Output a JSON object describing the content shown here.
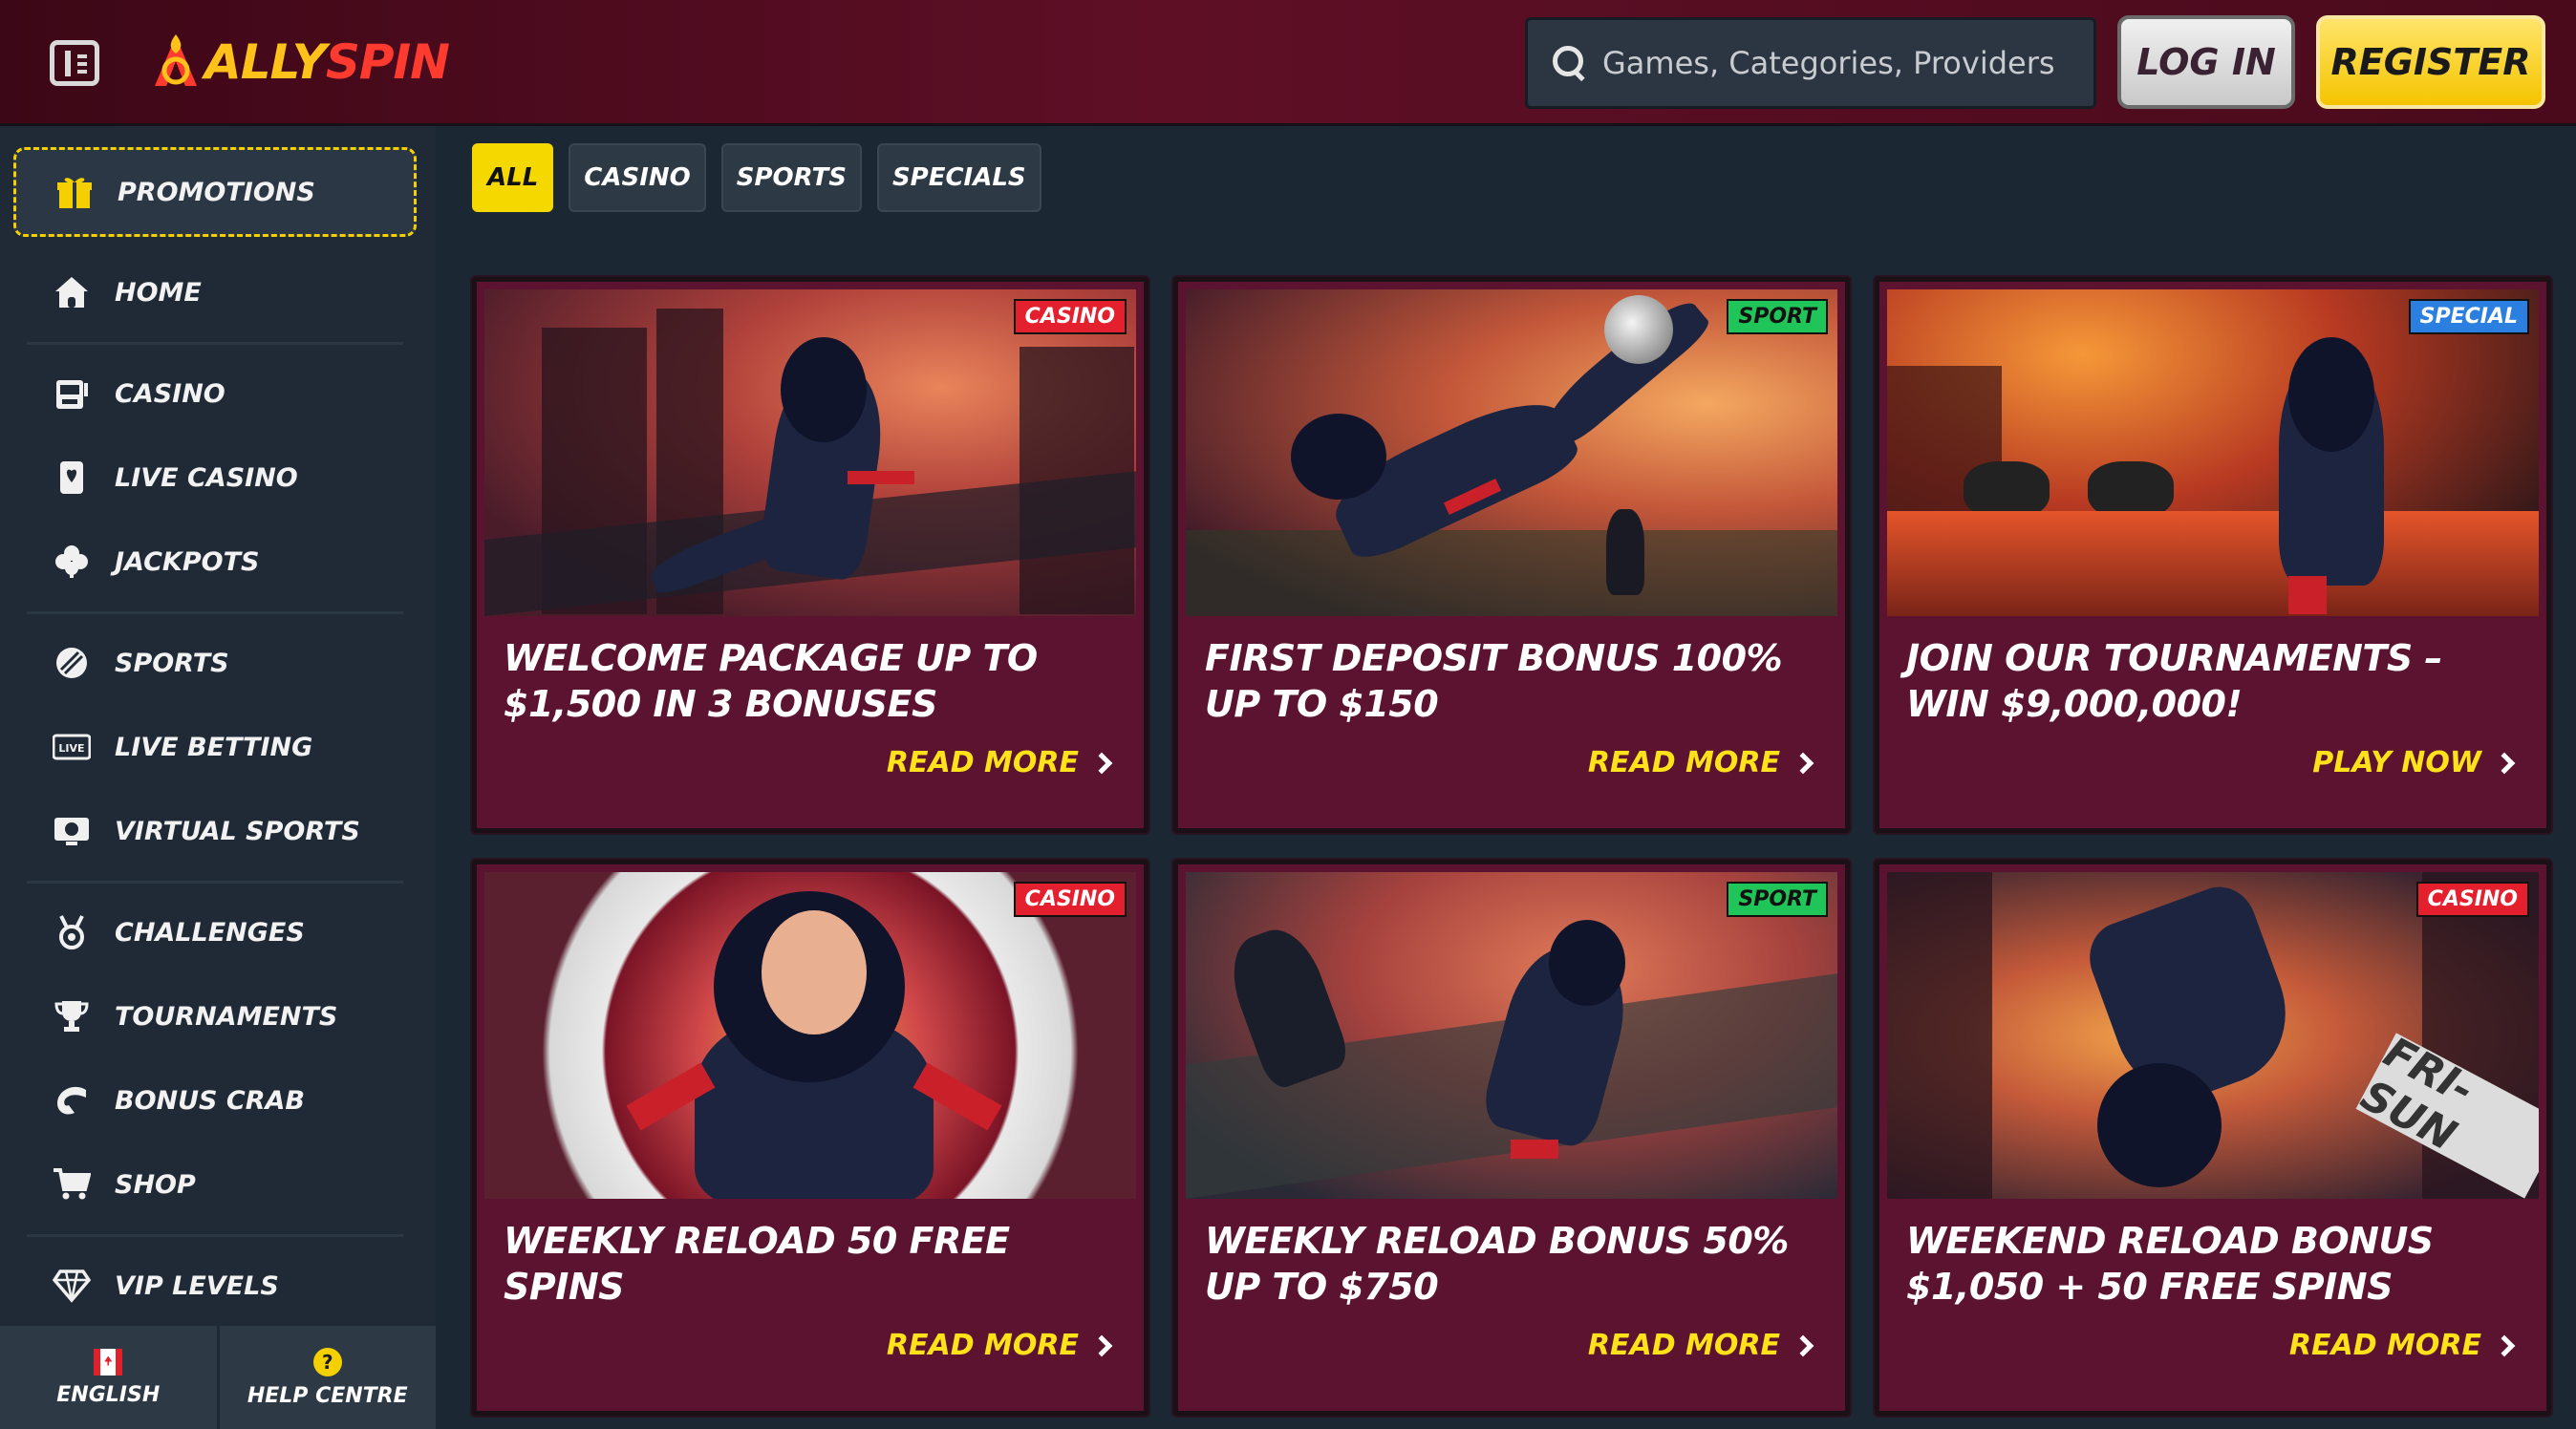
{
  "header": {
    "logo": "ALLYSPIN",
    "search_placeholder": "Games, Categories, Providers",
    "login_label": "LOG IN",
    "register_label": "REGISTER"
  },
  "sidebar": {
    "promotions_label": "PROMOTIONS",
    "items": [
      {
        "label": "HOME",
        "icon": "home-icon"
      },
      {
        "label": "CASINO",
        "icon": "slot-machine-icon"
      },
      {
        "label": "LIVE CASINO",
        "icon": "card-icon"
      },
      {
        "label": "JACKPOTS",
        "icon": "clover-icon"
      },
      {
        "label": "SPORTS",
        "icon": "football-icon"
      },
      {
        "label": "LIVE BETTING",
        "icon": "live-icon"
      },
      {
        "label": "VIRTUAL SPORTS",
        "icon": "virtual-sports-icon"
      },
      {
        "label": "CHALLENGES",
        "icon": "medal-icon"
      },
      {
        "label": "TOURNAMENTS",
        "icon": "trophy-icon"
      },
      {
        "label": "BONUS CRAB",
        "icon": "crab-claw-icon"
      },
      {
        "label": "SHOP",
        "icon": "cart-icon"
      },
      {
        "label": "VIP LEVELS",
        "icon": "diamond-icon"
      }
    ],
    "footer": {
      "language_label": "ENGLISH",
      "help_label": "HELP CENTRE",
      "help_glyph": "?"
    }
  },
  "filters": [
    {
      "label": "ALL",
      "active": true
    },
    {
      "label": "CASINO",
      "active": false
    },
    {
      "label": "SPORTS",
      "active": false
    },
    {
      "label": "SPECIALS",
      "active": false
    }
  ],
  "cards": [
    {
      "badge": "CASINO",
      "title": "WELCOME PACKAGE UP TO $1,500 IN 3 BONUSES",
      "cta": "READ MORE"
    },
    {
      "badge": "SPORT",
      "title": "FIRST DEPOSIT BONUS 100% UP TO $150",
      "cta": "READ MORE"
    },
    {
      "badge": "SPECIAL",
      "title": "JOIN OUR TOURNAMENTS – WIN $9,000,000!",
      "cta": "PLAY NOW"
    },
    {
      "badge": "CASINO",
      "title": "WEEKLY RELOAD 50 FREE SPINS",
      "cta": "READ MORE"
    },
    {
      "badge": "SPORT",
      "title": "WEEKLY RELOAD BONUS 50% UP TO $750",
      "cta": "READ MORE"
    },
    {
      "badge": "CASINO",
      "title": "WEEKEND RELOAD BONUS $1,050 + 50 FREE SPINS",
      "cta": "READ MORE",
      "image_sign_text": "FRI-SUN"
    }
  ],
  "colors": {
    "accent_yellow": "#f5d800",
    "card_bg": "#5b1330",
    "page_bg": "#1b2733",
    "badge_casino": "#e5202e",
    "badge_sport": "#20c55a",
    "badge_special": "#2a7fe0"
  }
}
